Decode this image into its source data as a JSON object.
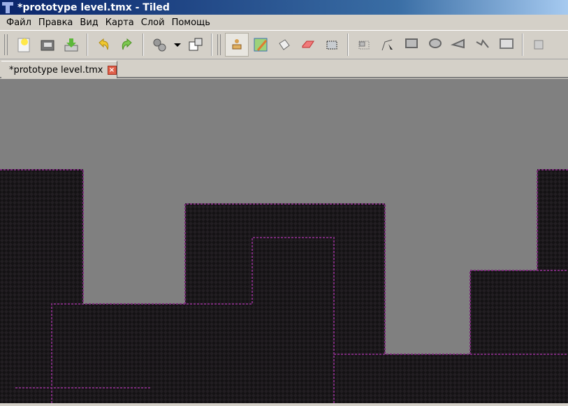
{
  "window": {
    "title": "*prototype level.tmx - Tiled"
  },
  "menu": [
    "Файл",
    "Правка",
    "Вид",
    "Карта",
    "Слой",
    "Помощь"
  ],
  "toolbar": {
    "buttons": [
      "new-icon",
      "open-icon",
      "save-icon",
      "undo-icon",
      "redo-icon",
      "automap-icon",
      "dropdown-arrow-icon",
      "random-icon",
      "stamp-brush-icon",
      "terrain-brush-icon",
      "bucket-fill-icon",
      "eraser-icon",
      "rect-select-icon",
      "select-objects-icon",
      "edit-polygons-icon",
      "insert-rectangle-icon",
      "insert-ellipse-icon",
      "insert-polygon-icon",
      "insert-polyline-icon",
      "insert-tile-icon",
      "move-icon"
    ],
    "active": "stamp-brush-icon"
  },
  "tabs": [
    {
      "label": "*prototype level.tmx"
    }
  ],
  "colors": {
    "background": "#808080",
    "tile": "#141214",
    "outline": "#6a2a6a"
  }
}
